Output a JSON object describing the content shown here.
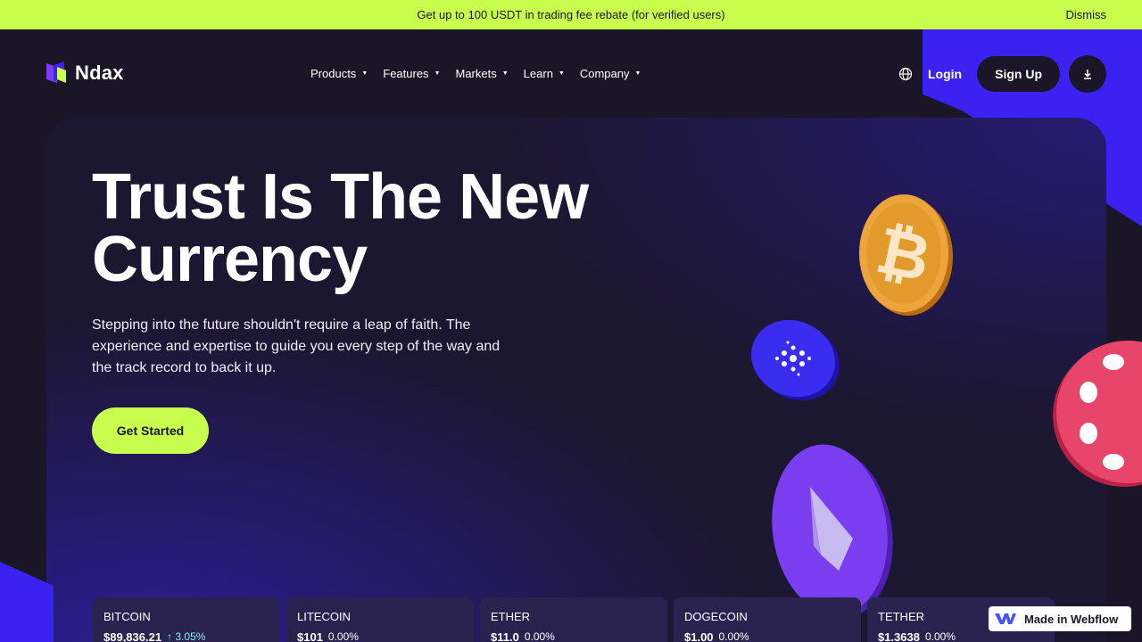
{
  "promo": {
    "text": "Get up to 100 USDT in trading fee rebate (for verified users)",
    "dismiss": "Dismiss"
  },
  "brand": {
    "name": "Ndax"
  },
  "nav": {
    "items": [
      {
        "label": "Products"
      },
      {
        "label": "Features"
      },
      {
        "label": "Markets"
      },
      {
        "label": "Learn"
      },
      {
        "label": "Company"
      }
    ],
    "login": "Login",
    "signup": "Sign Up"
  },
  "hero": {
    "headline": "Trust Is The New Currency",
    "subtext": "Stepping into the future shouldn't require a leap of faith. The experience and expertise to guide you every step of the way and the track record to back it up.",
    "cta": "Get Started"
  },
  "tickers": [
    {
      "name": "BITCOIN",
      "price": "$89,836.21",
      "change": "↑ 3.05%"
    },
    {
      "name": "LITECOIN",
      "price": "$101",
      "change": "0.00%"
    },
    {
      "name": "ETHER",
      "price": "$11.0",
      "change": "0.00%"
    },
    {
      "name": "DOGECOIN",
      "price": "$1.00",
      "change": "0.00%"
    },
    {
      "name": "TETHER",
      "price": "$1.3638",
      "change": "0.00%"
    }
  ],
  "badge": {
    "text": "Made in Webflow"
  },
  "colors": {
    "accent": "#c8fd4e",
    "brand_blue": "#3b22f0",
    "background": "#1a1628"
  }
}
